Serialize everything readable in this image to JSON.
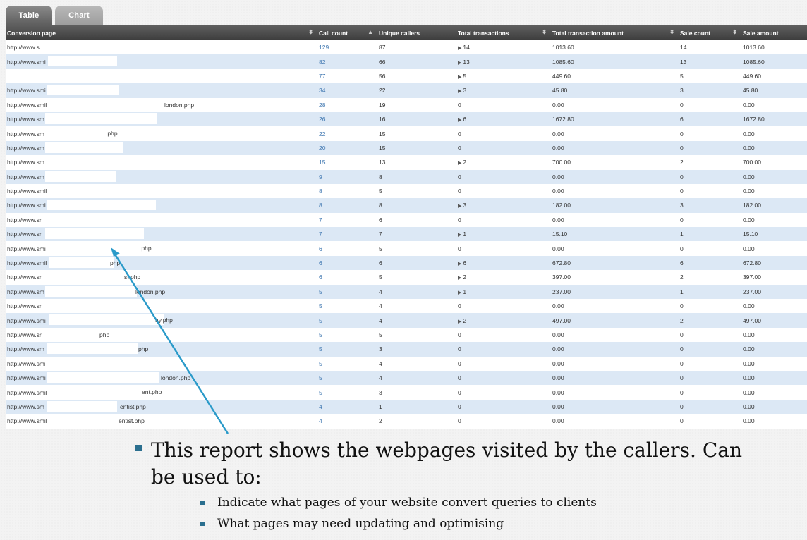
{
  "tabs": [
    {
      "label": "Table",
      "active": true
    },
    {
      "label": "Chart",
      "active": false
    }
  ],
  "columns": [
    {
      "label": "Conversion page",
      "sortable": true
    },
    {
      "label": "Call count",
      "sortable": true,
      "sorted": "desc"
    },
    {
      "label": "Unique callers",
      "sortable": true
    },
    {
      "label": "Total transactions",
      "sortable": true
    },
    {
      "label": "Total transaction amount",
      "sortable": true
    },
    {
      "label": "Sale count",
      "sortable": true
    },
    {
      "label": "Sale amount",
      "sortable": false
    }
  ],
  "rows": [
    {
      "page": "http://www.sr",
      "suffix": "",
      "calls": "129",
      "unique": "87",
      "trans": "14",
      "expandable": true,
      "amount": "1013.60",
      "sales": "14",
      "sale_amount": "1013.60"
    },
    {
      "page": "http://www.smi",
      "suffix": "",
      "calls": "82",
      "unique": "66",
      "trans": "13",
      "expandable": true,
      "amount": "1085.60",
      "sales": "13",
      "sale_amount": "1085.60"
    },
    {
      "page": "",
      "suffix": "",
      "calls": "77",
      "unique": "56",
      "trans": "5",
      "expandable": true,
      "amount": "449.60",
      "sales": "5",
      "sale_amount": "449.60"
    },
    {
      "page": "http://www.smi",
      "suffix": "",
      "calls": "34",
      "unique": "22",
      "trans": "3",
      "expandable": true,
      "amount": "45.80",
      "sales": "3",
      "sale_amount": "45.80"
    },
    {
      "page": "http://www.smil",
      "suffix": "london.php",
      "calls": "28",
      "unique": "19",
      "trans": "0",
      "expandable": false,
      "amount": "0.00",
      "sales": "0",
      "sale_amount": "0.00"
    },
    {
      "page": "http://www.sm",
      "suffix": "",
      "calls": "26",
      "unique": "16",
      "trans": "6",
      "expandable": true,
      "amount": "1672.80",
      "sales": "6",
      "sale_amount": "1672.80"
    },
    {
      "page": "http://www.sm",
      "suffix": ".php",
      "calls": "22",
      "unique": "15",
      "trans": "0",
      "expandable": false,
      "amount": "0.00",
      "sales": "0",
      "sale_amount": "0.00"
    },
    {
      "page": "http://www.sm",
      "suffix": "",
      "calls": "20",
      "unique": "15",
      "trans": "0",
      "expandable": false,
      "amount": "0.00",
      "sales": "0",
      "sale_amount": "0.00"
    },
    {
      "page": "http://www.sm",
      "suffix": "",
      "calls": "15",
      "unique": "13",
      "trans": "2",
      "expandable": true,
      "amount": "700.00",
      "sales": "2",
      "sale_amount": "700.00"
    },
    {
      "page": "http://www.sm",
      "suffix": "",
      "calls": "9",
      "unique": "8",
      "trans": "0",
      "expandable": false,
      "amount": "0.00",
      "sales": "0",
      "sale_amount": "0.00"
    },
    {
      "page": "http://www.smil",
      "suffix": "",
      "calls": "8",
      "unique": "5",
      "trans": "0",
      "expandable": false,
      "amount": "0.00",
      "sales": "0",
      "sale_amount": "0.00"
    },
    {
      "page": "http://www.smi",
      "suffix": "",
      "calls": "8",
      "unique": "8",
      "trans": "3",
      "expandable": true,
      "amount": "182.00",
      "sales": "3",
      "sale_amount": "182.00"
    },
    {
      "page": "http://www.sr",
      "suffix": "",
      "calls": "7",
      "unique": "6",
      "trans": "0",
      "expandable": false,
      "amount": "0.00",
      "sales": "0",
      "sale_amount": "0.00"
    },
    {
      "page": "http://www.sr",
      "suffix": "",
      "calls": "7",
      "unique": "7",
      "trans": "1",
      "expandable": true,
      "amount": "15.10",
      "sales": "1",
      "sale_amount": "15.10"
    },
    {
      "page": "http://www.smi",
      "suffix": ".php",
      "calls": "6",
      "unique": "5",
      "trans": "0",
      "expandable": false,
      "amount": "0.00",
      "sales": "0",
      "sale_amount": "0.00"
    },
    {
      "page": "http://www.smil",
      "suffix": "php",
      "calls": "6",
      "unique": "6",
      "trans": "6",
      "expandable": true,
      "amount": "672.80",
      "sales": "6",
      "sale_amount": "672.80"
    },
    {
      "page": "http://www.sr",
      "suffix": "st.php",
      "calls": "6",
      "unique": "5",
      "trans": "2",
      "expandable": true,
      "amount": "397.00",
      "sales": "2",
      "sale_amount": "397.00"
    },
    {
      "page": "http://www.sm",
      "suffix": "london.php",
      "calls": "5",
      "unique": "4",
      "trans": "1",
      "expandable": true,
      "amount": "237.00",
      "sales": "1",
      "sale_amount": "237.00"
    },
    {
      "page": "http://www.sr",
      "suffix": "",
      "calls": "5",
      "unique": "4",
      "trans": "0",
      "expandable": false,
      "amount": "0.00",
      "sales": "0",
      "sale_amount": "0.00"
    },
    {
      "page": "http://www.smi",
      "suffix": "ay.php",
      "calls": "5",
      "unique": "4",
      "trans": "2",
      "expandable": true,
      "amount": "497.00",
      "sales": "2",
      "sale_amount": "497.00"
    },
    {
      "page": "http://www.sr",
      "suffix": "php",
      "calls": "5",
      "unique": "5",
      "trans": "0",
      "expandable": false,
      "amount": "0.00",
      "sales": "0",
      "sale_amount": "0.00"
    },
    {
      "page": "http://www.sm",
      "suffix": "php",
      "calls": "5",
      "unique": "3",
      "trans": "0",
      "expandable": false,
      "amount": "0.00",
      "sales": "0",
      "sale_amount": "0.00"
    },
    {
      "page": "http://www.smi",
      "suffix": "",
      "calls": "5",
      "unique": "4",
      "trans": "0",
      "expandable": false,
      "amount": "0.00",
      "sales": "0",
      "sale_amount": "0.00"
    },
    {
      "page": "http://www.smi",
      "suffix": "london.php",
      "calls": "5",
      "unique": "4",
      "trans": "0",
      "expandable": false,
      "amount": "0.00",
      "sales": "0",
      "sale_amount": "0.00"
    },
    {
      "page": "http://www.smil",
      "suffix": "ent.php",
      "calls": "5",
      "unique": "3",
      "trans": "0",
      "expandable": false,
      "amount": "0.00",
      "sales": "0",
      "sale_amount": "0.00"
    },
    {
      "page": "http://www.sm",
      "suffix": "entist.php",
      "calls": "4",
      "unique": "1",
      "trans": "0",
      "expandable": false,
      "amount": "0.00",
      "sales": "0",
      "sale_amount": "0.00"
    },
    {
      "page": "http://www.smil",
      "suffix": "entist.php",
      "calls": "4",
      "unique": "2",
      "trans": "0",
      "expandable": false,
      "amount": "0.00",
      "sales": "0",
      "sale_amount": "0.00"
    }
  ],
  "caption": {
    "main": "This report shows the webpages visited by the callers. Can be used to:",
    "subs": [
      "Indicate what pages of your website  convert queries to clients",
      "What pages may need updating and optimising"
    ]
  },
  "colors": {
    "header_bg": "#4a4a4a",
    "row_alt": "#dce8f5",
    "link_blue": "#3e76b0",
    "annotation_arrow": "#2a9ac9",
    "bullet": "#2b6f8f"
  },
  "icons": {
    "sort": "sort-arrows-icon",
    "expand": "triangle-right-icon",
    "bullet": "square-bullet-icon"
  }
}
